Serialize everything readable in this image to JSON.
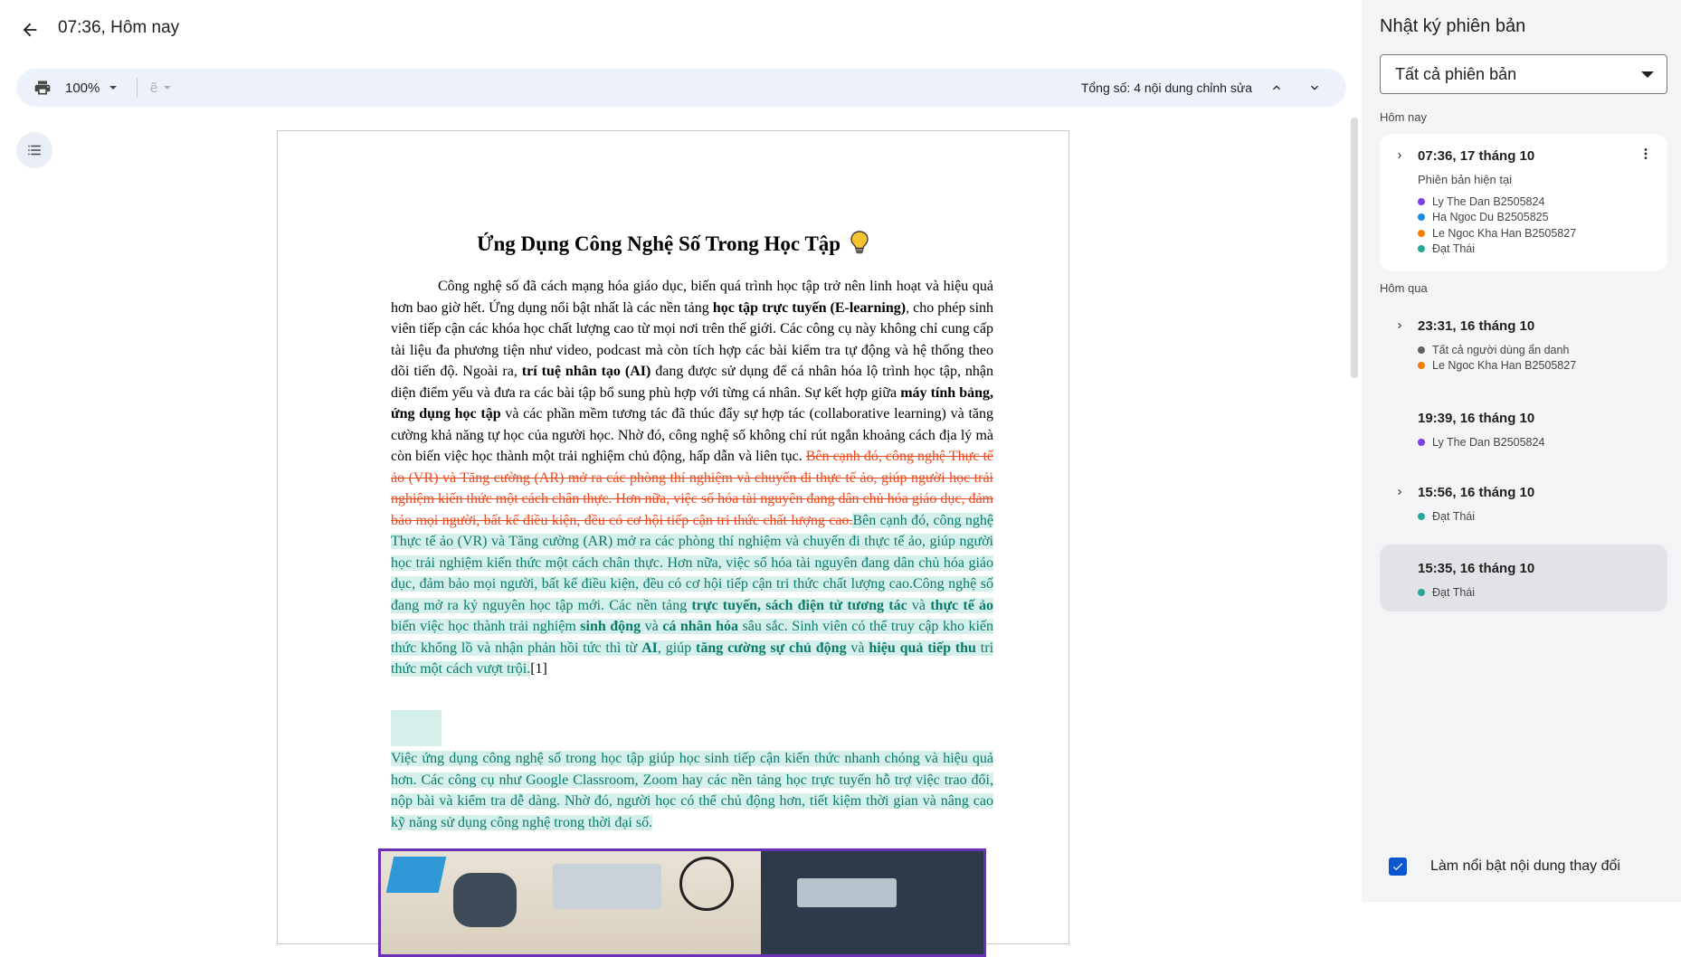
{
  "header": {
    "title": "07:36, Hôm nay"
  },
  "toolbar": {
    "zoom": "100%",
    "spell_glyph": "ẽ",
    "edit_count": "Tổng số: 4 nội dung chỉnh sửa"
  },
  "document": {
    "title": "Ứng Dụng Công Nghệ Số Trong Học Tập",
    "para1": [
      {
        "text": "Công nghệ số đã cách mạng hóa giáo dục, biến quá trình học tập trở nên linh hoạt và hiệu quả hơn bao giờ hết. Ứng dụng nổi bật nhất là các nền tảng ",
        "style": "plain"
      },
      {
        "text": "học tập trực tuyến (E-learning)",
        "style": "bold"
      },
      {
        "text": ", cho phép sinh viên tiếp cận các khóa học chất lượng cao từ mọi nơi trên thế giới. Các công cụ này không chỉ cung cấp tài liệu đa phương tiện như video, podcast mà còn tích hợp các bài kiểm tra tự động và hệ thống theo dõi tiến độ. Ngoài ra, ",
        "style": "plain"
      },
      {
        "text": "trí tuệ nhân tạo (AI)",
        "style": "bold"
      },
      {
        "text": " đang được sử dụng để cá nhân hóa lộ trình học tập, nhận diện điểm yếu và đưa ra các bài tập bổ sung phù hợp với từng cá nhân. Sự kết hợp giữa ",
        "style": "plain"
      },
      {
        "text": "máy tính bảng, ứng dụng học tập",
        "style": "bold"
      },
      {
        "text": " và các phần mềm tương tác đã thúc đẩy sự hợp tác (collaborative learning) và tăng cường khả năng tự học của người học. Nhờ đó, công nghệ số không chỉ rút ngắn khoảng cách địa lý mà còn biến việc học thành một trải nghiệm chủ động, hấp dẫn và liên tục. ",
        "style": "plain"
      },
      {
        "text": "Bên cạnh đó, công nghệ Thực tế ảo (VR) và Tăng cường (AR) mở ra các phòng thí nghiệm và chuyến đi thực tế ảo, giúp người học trải nghiệm kiến thức một cách chân thực. Hơn nữa, việc số hóa tài nguyên đang dân chủ hóa giáo dục, đảm bảo mọi người, bất kể điều kiện, đều có cơ hội tiếp cận tri thức chất lượng cao.",
        "style": "del"
      },
      {
        "text": "Bên cạnh đó, công nghệ Thực tế ảo (VR) và Tăng cường (AR) mở ra các phòng thí nghiệm và chuyến đi thực tế ảo, giúp người học trải nghiệm kiến thức một cách chân thực. Hơn nữa, việc số hóa tài nguyên đang dân chủ hóa giáo dục, đảm bảo mọi người, bất kể điều kiện, đều có cơ hội tiếp cận tri thức chất lượng cao.Công nghệ số đang mở ra kỷ nguyên học tập mới. Các nền tảng ",
        "style": "ins"
      },
      {
        "text": "trực tuyến, sách điện tử tương tác",
        "style": "ins-bold"
      },
      {
        "text": " và ",
        "style": "ins"
      },
      {
        "text": "thực tế ảo",
        "style": "ins-bold"
      },
      {
        "text": " biến việc học thành trải nghiệm ",
        "style": "ins"
      },
      {
        "text": "sinh động",
        "style": "ins-bold"
      },
      {
        "text": " và ",
        "style": "ins"
      },
      {
        "text": "cá nhân hóa",
        "style": "ins-bold"
      },
      {
        "text": " sâu sắc. Sinh viên có thể truy cập kho kiến thức khổng lồ và nhận phản hồi tức thì từ ",
        "style": "ins"
      },
      {
        "text": "AI",
        "style": "ins-bold"
      },
      {
        "text": ", giúp ",
        "style": "ins"
      },
      {
        "text": "tăng cường sự chủ động",
        "style": "ins-bold"
      },
      {
        "text": " và ",
        "style": "ins"
      },
      {
        "text": "hiệu quả tiếp thu",
        "style": "ins-bold"
      },
      {
        "text": " tri thức một cách vượt trội.",
        "style": "ins"
      },
      {
        "text": "[1]",
        "style": "ref"
      }
    ],
    "para2": "Việc ứng dụng công nghệ số trong học tập giúp học sinh tiếp cận kiến thức nhanh chóng và hiệu quả hơn. Các công cụ như Google Classroom, Zoom hay các nền tảng học trực tuyến hỗ trợ việc trao đổi, nộp bài và kiểm tra dễ dàng. Nhờ đó, người học có thể chủ động hơn, tiết kiệm thời gian và nâng cao kỹ năng sử dụng công nghệ trong thời đại số."
  },
  "panel": {
    "title": "Nhật ký phiên bản",
    "filter_selected": "Tất cả phiên bản",
    "group_today": "Hôm nay",
    "group_yesterday": "Hôm qua",
    "versions": [
      {
        "time": "07:36, 17 tháng 10",
        "subtitle": "Phiên bản hiện tại",
        "editors": [
          {
            "name": "Ly The Dan B2505824",
            "color": "#7b3fe4"
          },
          {
            "name": "Ha Ngoc Du B2505825",
            "color": "#1e88e5"
          },
          {
            "name": "Le Ngoc Kha Han B2505827",
            "color": "#f57c00"
          },
          {
            "name": "Đạt Thái",
            "color": "#26a69a"
          }
        ]
      },
      {
        "time": "23:31, 16 tháng 10",
        "editors": [
          {
            "name": "Tất cả người dùng ẩn danh",
            "color": "#616161"
          },
          {
            "name": "Le Ngoc Kha Han B2505827",
            "color": "#f57c00"
          }
        ]
      },
      {
        "time": "19:39, 16 tháng 10",
        "editors": [
          {
            "name": "Ly The Dan B2505824",
            "color": "#7b3fe4"
          }
        ]
      },
      {
        "time": "15:56, 16 tháng 10",
        "editors": [
          {
            "name": "Đạt Thái",
            "color": "#26a69a"
          }
        ]
      },
      {
        "time": "15:35, 16 tháng 10",
        "editors": [
          {
            "name": "Đạt Thái",
            "color": "#26a69a"
          }
        ]
      }
    ],
    "highlight_label": "Làm nổi bật nội dung thay đổi",
    "highlight_checked": true
  },
  "colors": {
    "accent": "#0b57d0",
    "deleted": "#e8491f",
    "inserted": "#0b7a6a",
    "inserted_bg": "#d5f0ea",
    "selected_card": "#e1e3e6"
  }
}
